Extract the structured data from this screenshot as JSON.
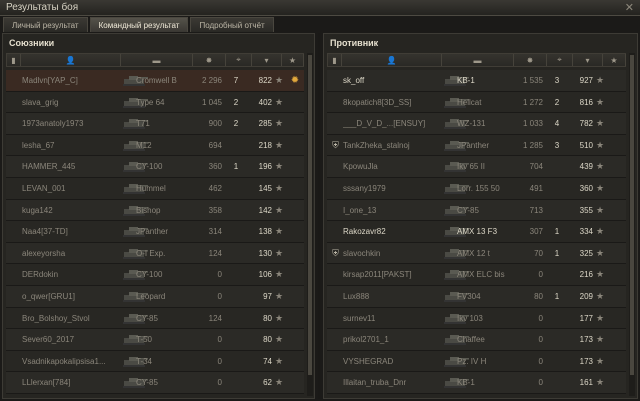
{
  "window": {
    "title": "Результаты боя",
    "close_icon": "close-icon"
  },
  "tabs": [
    {
      "label": "Личный результат",
      "active": false
    },
    {
      "label": "Командный результат",
      "active": true
    },
    {
      "label": "Подробный отчёт",
      "active": false
    }
  ],
  "allies": {
    "title": "Союзники",
    "rows": [
      {
        "name": "Madlvn[YAP_C]",
        "tank": "Cromwell B",
        "damage": "2 296",
        "kills": "7",
        "xp": "822",
        "alive": false,
        "self": true,
        "medal": true
      },
      {
        "name": "slava_grig",
        "tank": "Type 64",
        "damage": "1 045",
        "kills": "2",
        "xp": "402",
        "alive": false
      },
      {
        "name": "1973anatoly1973",
        "tank": "T71",
        "damage": "900",
        "kills": "2",
        "xp": "285",
        "alive": false
      },
      {
        "name": "lesha_67",
        "tank": "M12",
        "damage": "694",
        "kills": "",
        "xp": "218",
        "alive": false
      },
      {
        "name": "HAMMER_445",
        "tank": "CY-100",
        "damage": "360",
        "kills": "1",
        "xp": "196",
        "alive": false
      },
      {
        "name": "LEVAN_001",
        "tank": "Hummel",
        "damage": "462",
        "kills": "",
        "xp": "145",
        "alive": false
      },
      {
        "name": "kuga142",
        "tank": "Bishop",
        "damage": "358",
        "kills": "",
        "xp": "142",
        "alive": false
      },
      {
        "name": "Naa4[37-TD]",
        "tank": "JPanther",
        "damage": "314",
        "kills": "",
        "xp": "138",
        "alive": false
      },
      {
        "name": "alexeyorsha",
        "tank": "O-I Exp.",
        "damage": "124",
        "kills": "",
        "xp": "130",
        "alive": false
      },
      {
        "name": "DERdokin",
        "tank": "CY-100",
        "damage": "0",
        "kills": "",
        "xp": "106",
        "alive": false
      },
      {
        "name": "o_qwer[GRU1]",
        "tank": "Leopard",
        "damage": "0",
        "kills": "",
        "xp": "97",
        "alive": false
      },
      {
        "name": "Bro_Bolshoy_Stvol",
        "tank": "CY-85",
        "damage": "124",
        "kills": "",
        "xp": "80",
        "alive": false
      },
      {
        "name": "Sever60_2017",
        "tank": "T-50",
        "damage": "0",
        "kills": "",
        "xp": "80",
        "alive": false
      },
      {
        "name": "Vsadnikapokalipsisa1...",
        "tank": "T-34",
        "damage": "0",
        "kills": "",
        "xp": "74",
        "alive": false
      },
      {
        "name": "LLlerxan[784]",
        "tank": "CY-85",
        "damage": "0",
        "kills": "",
        "xp": "62",
        "alive": false
      }
    ]
  },
  "enemies": {
    "title": "Противник",
    "rows": [
      {
        "name": "sk_off",
        "tank": "KB-1",
        "damage": "1 535",
        "kills": "3",
        "xp": "927",
        "alive": true
      },
      {
        "name": "8kopatich8[3D_SS]",
        "tank": "Hellcat",
        "damage": "1 272",
        "kills": "2",
        "xp": "816",
        "alive": false
      },
      {
        "name": "___D_V_D_...[ENSUY]",
        "tank": "WZ-131",
        "damage": "1 033",
        "kills": "4",
        "xp": "782",
        "alive": false
      },
      {
        "name": "TankZheka_stalnoj",
        "tank": "JPanther",
        "damage": "1 285",
        "kills": "3",
        "xp": "510",
        "alive": false,
        "icon": true
      },
      {
        "name": "KpowuJla",
        "tank": "Ikv 65 II",
        "damage": "704",
        "kills": "",
        "xp": "439",
        "alive": false
      },
      {
        "name": "sssany1979",
        "tank": "Lorr. 155 50",
        "damage": "491",
        "kills": "",
        "xp": "360",
        "alive": false
      },
      {
        "name": "I_one_13",
        "tank": "CY-85",
        "damage": "713",
        "kills": "",
        "xp": "355",
        "alive": false
      },
      {
        "name": "Rakozavr82",
        "tank": "AMX 13 F3",
        "damage": "307",
        "kills": "1",
        "xp": "334",
        "alive": true
      },
      {
        "name": "slavochkin",
        "tank": "AMX 12 t",
        "damage": "70",
        "kills": "1",
        "xp": "325",
        "alive": false,
        "icon": true
      },
      {
        "name": "kirsap2011[PAKST]",
        "tank": "AMX ELC bis",
        "damage": "0",
        "kills": "",
        "xp": "216",
        "alive": false
      },
      {
        "name": "Lux888",
        "tank": "FV304",
        "damage": "80",
        "kills": "1",
        "xp": "209",
        "alive": false
      },
      {
        "name": "surnev11",
        "tank": "Ikv 103",
        "damage": "0",
        "kills": "",
        "xp": "177",
        "alive": false
      },
      {
        "name": "prikol2701_1",
        "tank": "Chaffee",
        "damage": "0",
        "kills": "",
        "xp": "173",
        "alive": false
      },
      {
        "name": "VYSHEGRAD",
        "tank": "Pz. IV H",
        "damage": "0",
        "kills": "",
        "xp": "173",
        "alive": false
      },
      {
        "name": "Illaitan_truba_Dnr",
        "tank": "KB-1",
        "damage": "0",
        "kills": "",
        "xp": "161",
        "alive": false
      }
    ]
  }
}
